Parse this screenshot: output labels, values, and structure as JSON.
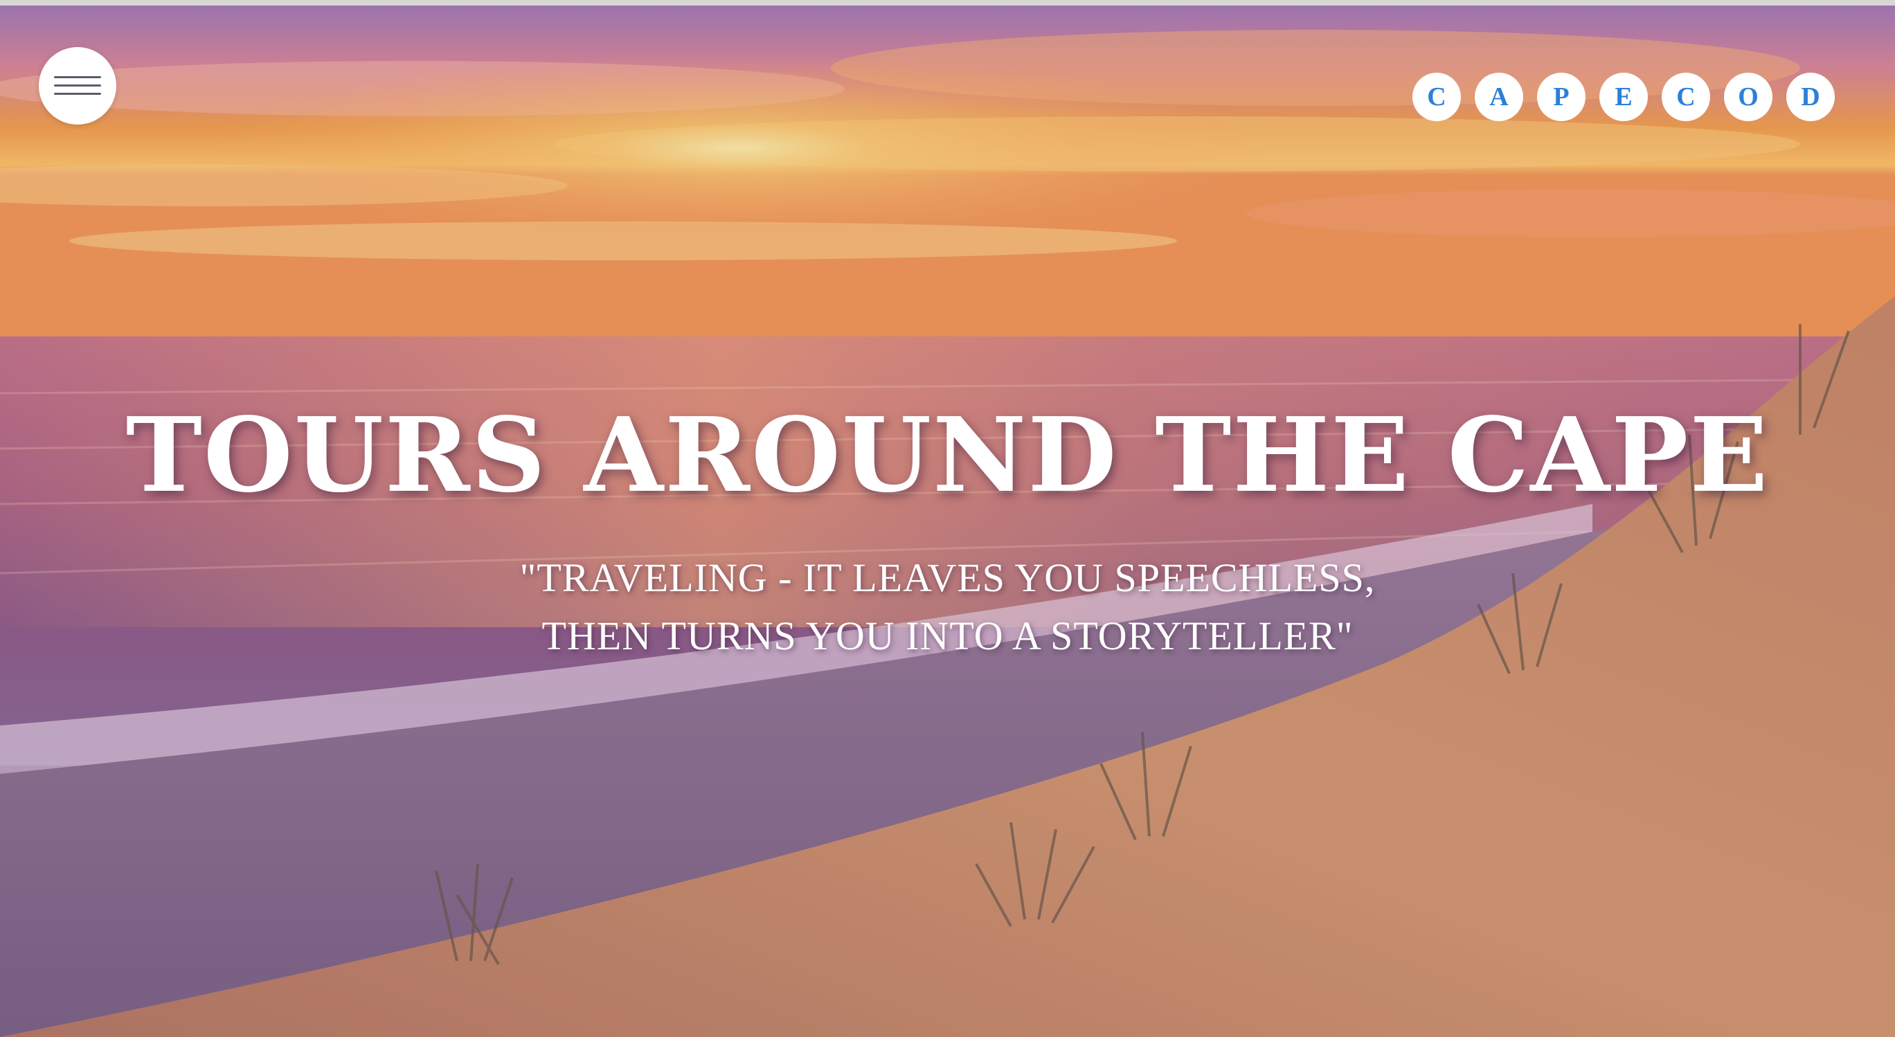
{
  "nav": {
    "menu_icon": "hamburger-menu-icon"
  },
  "logo": {
    "letters": [
      "C",
      "A",
      "P",
      "E",
      "C",
      "O",
      "D"
    ],
    "color": "#2d7fd6"
  },
  "hero": {
    "title": "TOURS AROUND THE CAPE",
    "quote_line1": "\"TRAVELING - IT LEAVES YOU SPEECHLESS,",
    "quote_line2": "THEN TURNS YOU INTO A STORYTELLER\"",
    "background": "sunset-over-beach-dunes"
  }
}
